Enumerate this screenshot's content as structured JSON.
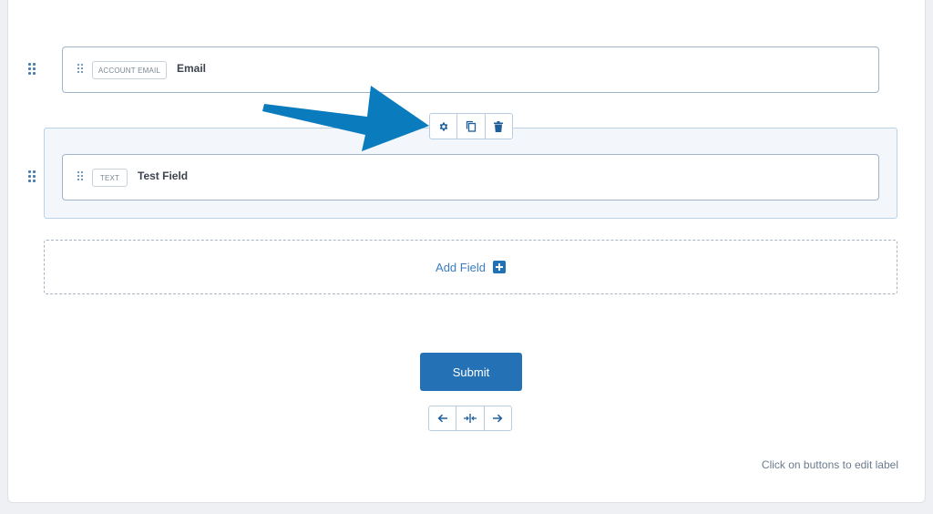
{
  "fields": [
    {
      "type_tag": "ACCOUNT EMAIL",
      "label": "Email"
    },
    {
      "type_tag": "TEXT",
      "label": "Test Field"
    }
  ],
  "field_toolbar": {
    "icons": [
      "gear-icon",
      "copy-icon",
      "trash-icon"
    ]
  },
  "add_field": {
    "label": "Add Field",
    "icon": "plus-icon"
  },
  "submit": {
    "label": "Submit"
  },
  "alignment": {
    "icons": [
      "arrow-left-icon",
      "align-center-icon",
      "arrow-right-icon"
    ]
  },
  "hint": "Click on buttons to edit label",
  "colors": {
    "accent": "#2471b5",
    "annotation_arrow": "#0a7bbd",
    "border": "#9fb4c8",
    "selected_bg": "#f3f7fb"
  }
}
